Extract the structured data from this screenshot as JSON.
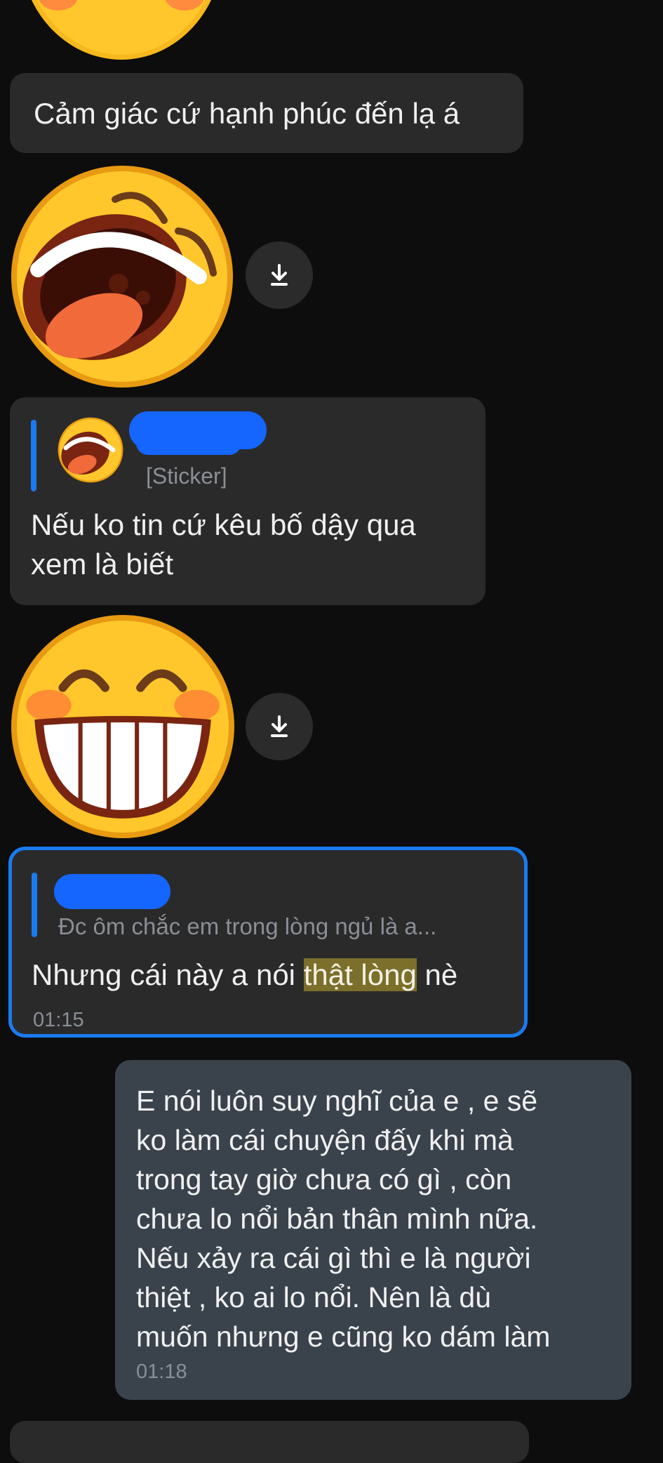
{
  "messages": {
    "m1": {
      "text": "Cảm giác cứ hạnh phúc đến lạ á"
    },
    "m2": {
      "quote_sender": "",
      "quote_preview": "[Sticker]",
      "text": "Nếu ko tin cứ kêu bố dậy qua\nxem là biết"
    },
    "m3": {
      "quote_sender": "",
      "quote_preview": "Đc ôm chắc em trong lòng ngủ là a...",
      "text_before": "Nhưng cái này a nói ",
      "text_highlight": "thật lòng",
      "text_after": " nè",
      "time": "01:15"
    },
    "m4": {
      "text": "E nói luôn suy nghĩ của e , e sẽ\nko làm cái chuyện đấy khi mà\ntrong tay giờ chưa có gì , còn\nchưa lo nổi bản thân mình nữa.\nNếu xảy ra cái gì thì e là người\nthiệt , ko ai lo nổi. Nên là dù\nmuốn nhưng e cũng ko dám làm",
      "time": "01:18"
    }
  },
  "stickers": {
    "s1": {
      "icon": "laughing-emoji-sticker"
    },
    "s2": {
      "icon": "grinning-emoji-sticker"
    }
  },
  "colors": {
    "background": "#0d0d0d",
    "bubble_in": "#2a2a2a",
    "bubble_out": "#3a434c",
    "accent": "#1a7bf0",
    "highlight": "#7b6f2b"
  }
}
